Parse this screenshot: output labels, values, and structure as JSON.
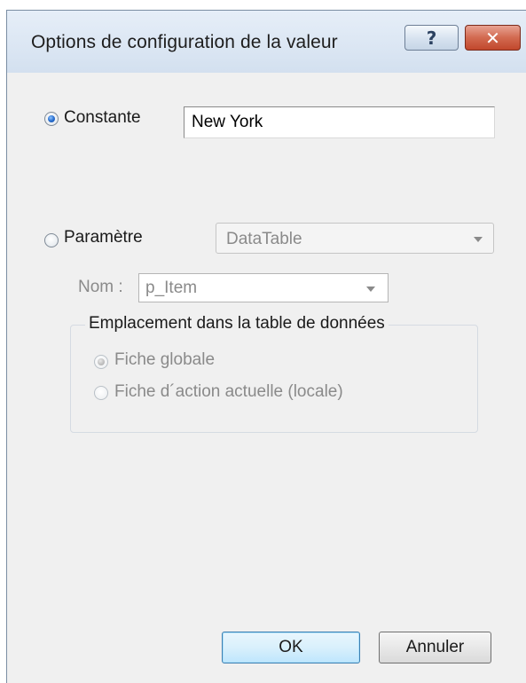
{
  "dialog": {
    "title": "Options de configuration de la valeur",
    "help_button_label": "?",
    "close_button_label": "✕"
  },
  "constant": {
    "label": "Constante",
    "selected": true,
    "value": "New York"
  },
  "parameter": {
    "label": "Paramètre",
    "selected": false,
    "type_value": "DataTable",
    "name_label": "Nom :",
    "name_value": "p_Item"
  },
  "location_group": {
    "title": "Emplacement dans la table de données",
    "options": [
      {
        "label": "Fiche globale",
        "selected": true
      },
      {
        "label": "Fiche d´action actuelle (locale)",
        "selected": false
      }
    ]
  },
  "buttons": {
    "ok_label": "OK",
    "cancel_label": "Annuler"
  }
}
